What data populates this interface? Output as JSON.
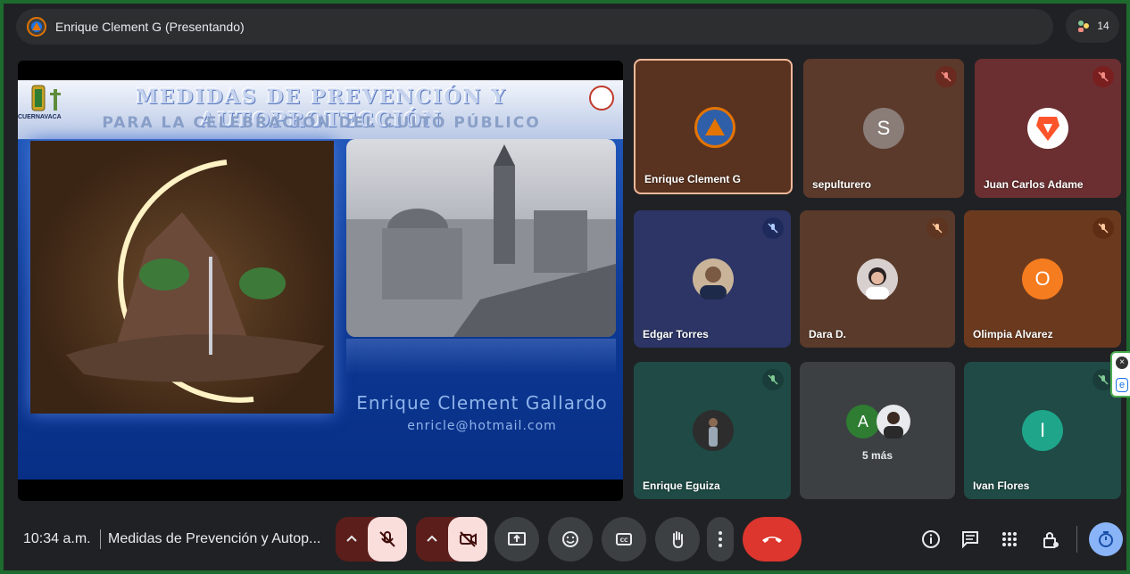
{
  "header": {
    "presenting_title": "Enrique Clement G (Presentando)",
    "participant_count": "14"
  },
  "slide": {
    "title_line1": "MEDIDAS DE PREVENCIÓN Y AUTOPROTECCIÓN",
    "title_line2": "PARA LA CELEBRACIÓN DEL CULTO PÚBLICO",
    "city_label": "CUERNAVACA",
    "presenter_name": "Enrique Clement Gallardo",
    "presenter_email": "enricle@hotmail.com"
  },
  "tiles": [
    {
      "name": "Enrique Clement G",
      "avatar": "",
      "muted": false,
      "active": true,
      "bg": "#5a3320"
    },
    {
      "name": "sepulturero",
      "avatar": "S",
      "muted": true,
      "bg": "#5b3a2c"
    },
    {
      "name": "Juan Carlos Adame",
      "avatar": "",
      "muted": true,
      "bg": "#6b2f31"
    },
    {
      "name": "Edgar Torres",
      "avatar": "",
      "muted": true,
      "bg": "#2c3566"
    },
    {
      "name": "Dara D.",
      "avatar": "",
      "muted": true,
      "bg": "#5a3a2a"
    },
    {
      "name": "Olimpia Alvarez",
      "avatar": "O",
      "muted": true,
      "bg": "#6b3a1e"
    },
    {
      "name": "Enrique Eguiza",
      "avatar": "",
      "muted": true,
      "bg": "#1f4a45"
    },
    {
      "name": "5 más",
      "avatar": "A",
      "muted": false,
      "bg": "#3c4043"
    },
    {
      "name": "Ivan Flores",
      "avatar": "I",
      "muted": true,
      "bg": "#1f4a45"
    }
  ],
  "bottom": {
    "time": "10:34 a.m.",
    "meeting_title": "Medidas de Prevención y Autop..."
  },
  "icons": {
    "mic_off": "mic-off-icon",
    "cam_off": "camera-off-icon",
    "present": "present-screen-icon",
    "emoji": "emoji-icon",
    "captions": "captions-icon",
    "raise_hand": "raise-hand-icon",
    "more": "more-vert-icon",
    "end_call": "end-call-icon",
    "info": "info-icon",
    "chat": "chat-icon",
    "activities": "apps-grid-icon",
    "host_controls": "host-lock-icon",
    "timer": "timer-icon"
  },
  "colors": {
    "end_call": "#dc362e",
    "toggle_off": "#f9dedc",
    "frame_border": "#1e6b2f",
    "accent_orange": "#e37400"
  }
}
